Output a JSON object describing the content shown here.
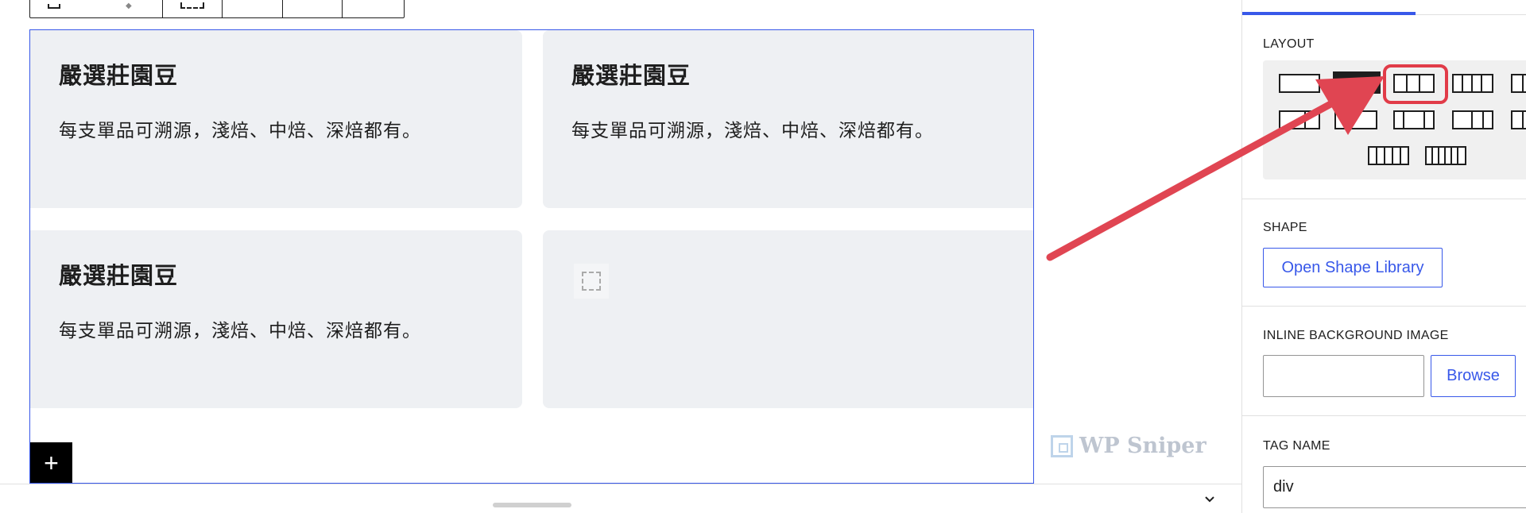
{
  "cards": [
    {
      "title": "嚴選莊園豆",
      "text": "每支單品可溯源，淺焙、中焙、深焙都有。"
    },
    {
      "title": "嚴選莊園豆",
      "text": "每支單品可溯源，淺焙、中焙、深焙都有。"
    },
    {
      "title": "嚴選莊園豆",
      "text": "每支單品可溯源，淺焙、中焙、深焙都有。"
    }
  ],
  "add_block": {
    "symbol": "+"
  },
  "watermark": {
    "text": "WP Sniper"
  },
  "sidebar": {
    "layout": {
      "label": "LAYOUT",
      "selected_option": "3 equal columns"
    },
    "shape": {
      "label": "SHAPE",
      "button": "Open Shape Library"
    },
    "inline_bg": {
      "label": "INLINE BACKGROUND IMAGE",
      "value": "",
      "button": "Browse"
    },
    "tag_name": {
      "label": "TAG NAME",
      "value": "div"
    }
  },
  "colors": {
    "accent": "#3858e9",
    "annotation": "#e13b48",
    "card_background": "#eef0f3"
  }
}
